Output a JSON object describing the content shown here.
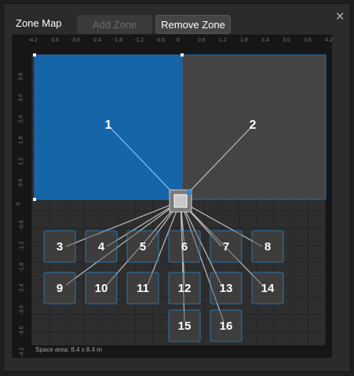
{
  "dialog": {
    "title": "Zone Map",
    "add_zone_label": "Add Zone",
    "remove_zone_label": "Remove Zone",
    "close_icon": "×",
    "space_area": "Space area: 8.4 x 8.4 m"
  },
  "axes": {
    "x_ticks": [
      "-4.2",
      "-3.6",
      "-3.0",
      "-2.4",
      "-1.8",
      "-1.2",
      "-0.6",
      "0",
      "0.6",
      "1.2",
      "1.8",
      "2.4",
      "3.0",
      "3.6",
      "4.2"
    ],
    "y_ticks": [
      "3.6",
      "3.0",
      "2.4",
      "1.8",
      "1.2",
      "0.6",
      "0",
      "-0.6",
      "-1.2",
      "-1.8",
      "-2.4",
      "-3.0",
      "-3.6",
      "-4.2"
    ]
  },
  "zones": [
    {
      "label": "1",
      "selected": true
    },
    {
      "label": "2",
      "selected": false
    }
  ],
  "speakers": [
    "3",
    "4",
    "5",
    "6",
    "7",
    "8",
    "9",
    "10",
    "11",
    "12",
    "13",
    "14",
    "15",
    "16"
  ],
  "colors": {
    "zone_selected": "#1565a8",
    "zone_unselected": "#444444",
    "zone_border": "#1f6fb0",
    "speaker_border": "#2b6a96",
    "line_selected": "#8fc3ee",
    "line_default": "#bfbfbf"
  }
}
